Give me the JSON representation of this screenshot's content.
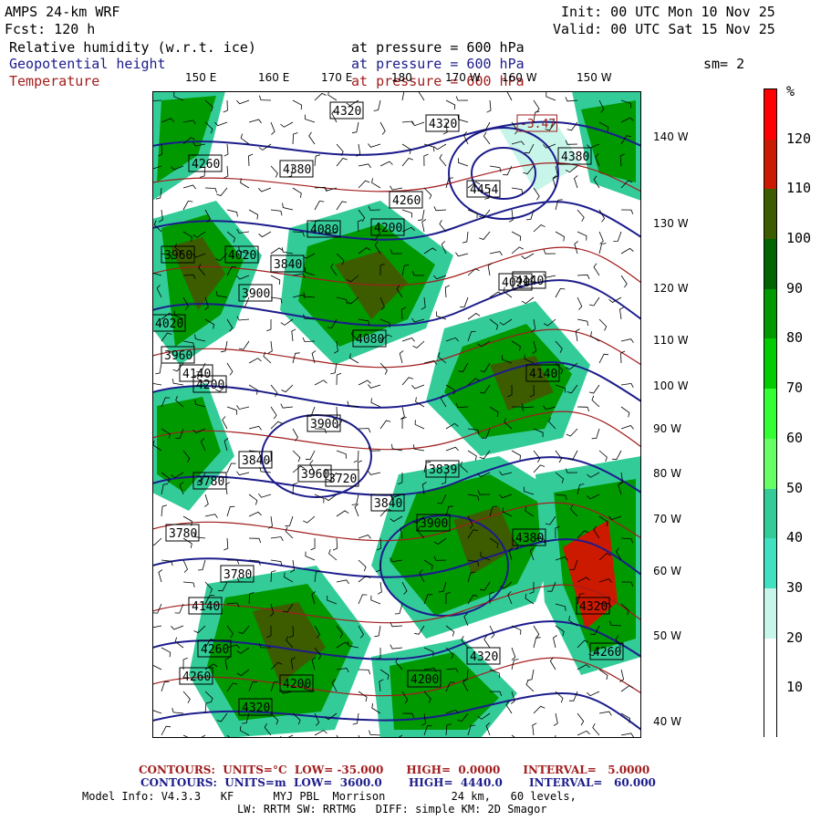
{
  "header": {
    "model": "AMPS 24-km WRF",
    "fcst": "Fcst: 120 h",
    "init": "Init: 00 UTC Mon 10 Nov 25",
    "valid": "Valid: 00 UTC Sat 15 Nov 25"
  },
  "fields": [
    {
      "name": "Relative humidity (w.r.t. ice)",
      "pressure": "at pressure = 600 hPa",
      "color": "#000000"
    },
    {
      "name": "Geopotential height",
      "pressure": "at pressure = 600 hPa",
      "color": "#1c1c8c"
    },
    {
      "name": "Temperature",
      "pressure": "at pressure = 600 hPa",
      "color": "#a21d1d"
    }
  ],
  "smoothing": "sm= 2",
  "lon_top_labels": [
    "150 E",
    "160 E",
    "170 E",
    "180",
    "170 W",
    "160 W",
    "150 W"
  ],
  "lon_right_labels": [
    "140 W",
    "130 W",
    "120 W",
    "110 W",
    "100 W",
    "90 W",
    "80 W",
    "70 W",
    "60 W",
    "50 W",
    "40 W"
  ],
  "contour_labels": [
    "4320",
    "4320",
    "4380",
    "4260",
    "4380",
    "4454",
    "4260",
    "4200",
    "4080",
    "4020",
    "3960",
    "4020",
    "3840",
    "3900",
    "3960",
    "4140",
    "4200",
    "4080",
    "4020",
    "3900",
    "3780",
    "3840",
    "3960",
    "3780",
    "3720",
    "3839",
    "3840",
    "3900",
    "3780",
    "4140",
    "4260",
    "4200",
    "4320",
    "4260",
    "4320",
    "4380",
    "4140",
    "4140",
    "4260",
    "4200",
    "4320",
    "-3.47"
  ],
  "colorbar": {
    "unit": "%",
    "labels": [
      "120",
      "110",
      "100",
      "90",
      "80",
      "70",
      "60",
      "50",
      "40",
      "30",
      "20",
      "10"
    ],
    "colors": [
      "#ff0000",
      "#cc1a00",
      "#3d5c00",
      "#006400",
      "#009900",
      "#00cc00",
      "#33ff33",
      "#66ff66",
      "#33cc99",
      "#40e0c0",
      "#c8f5ea",
      "#ffffff",
      "#ffffff"
    ]
  },
  "footer": {
    "temp_contours": "CONTOURS:  UNITS=°C  LOW= -35.000      HIGH=  0.0000      INTERVAL=   5.0000",
    "hgt_contours": "CONTOURS:  UNITS=m  LOW=  3600.0       HIGH=  4440.0       INTERVAL=   60.000",
    "model_info": "Model Info: V4.3.3   KF      MYJ PBL  Morrison          24 km,   60 levels,",
    "physics": "LW: RRTM SW: RRTMG   DIFF: simple KM: 2D Smagor"
  }
}
